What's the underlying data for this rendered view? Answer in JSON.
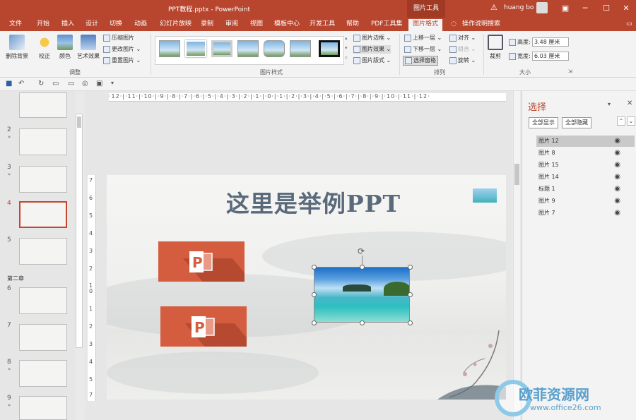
{
  "window": {
    "title": "PPT教程.pptx  -  PowerPoint",
    "context_tab": "图片工具",
    "user": "huang bo"
  },
  "tabs": [
    "文件",
    "开始",
    "插入",
    "设计",
    "切换",
    "动画",
    "幻灯片放映",
    "录制",
    "审阅",
    "视图",
    "模板中心",
    "开发工具",
    "帮助",
    "PDF工具集",
    "图片格式",
    "操作说明搜索"
  ],
  "ribbon": {
    "adjust": {
      "label": "调整",
      "remove_bg": "删除背景",
      "correct": "校正",
      "color": "颜色",
      "art": "艺术效果",
      "compress": "压缩图片",
      "change": "更改图片",
      "reset": "重置图片"
    },
    "styles": {
      "label": "图片样式",
      "border": "图片边框",
      "effect": "图片效果",
      "layout": "图片版式"
    },
    "arrange": {
      "label": "排列",
      "forward": "上移一层",
      "backward": "下移一层",
      "pane": "选择窗格",
      "align": "对齐",
      "group": "组合",
      "rotate": "旋转"
    },
    "size": {
      "label": "大小",
      "crop": "裁剪",
      "height_label": "高度:",
      "height": "3.48 厘米",
      "width_label": "宽度:",
      "width": "6.03 厘米"
    }
  },
  "ruler": {
    "h": "·12·|·11·|·10·|·9·|·8·|·7·|·6·|·5·|·4·|·3·|·2·|·1·|·0·|·1·|·2·|·3·|·4·|·5·|·6·|·7·|·8·|·9·|·10·|·11·|·12·"
  },
  "thumbs": {
    "n2": "2",
    "n3": "3",
    "n4": "4",
    "n5": "5",
    "chapter": "第二章",
    "n6": "6",
    "n7": "7",
    "n8": "8",
    "n9": "9",
    "star": "*"
  },
  "slide": {
    "title": "这里是举例PPT"
  },
  "pane": {
    "title": "选择",
    "show_all": "全部显示",
    "hide_all": "全部隐藏",
    "items": [
      "图片 12",
      "图片 8",
      "图片 15",
      "图片 14",
      "标题 1",
      "图片 9",
      "图片 7"
    ]
  },
  "watermark": {
    "text": "欧菲资源网",
    "url": "www.office26.com"
  }
}
